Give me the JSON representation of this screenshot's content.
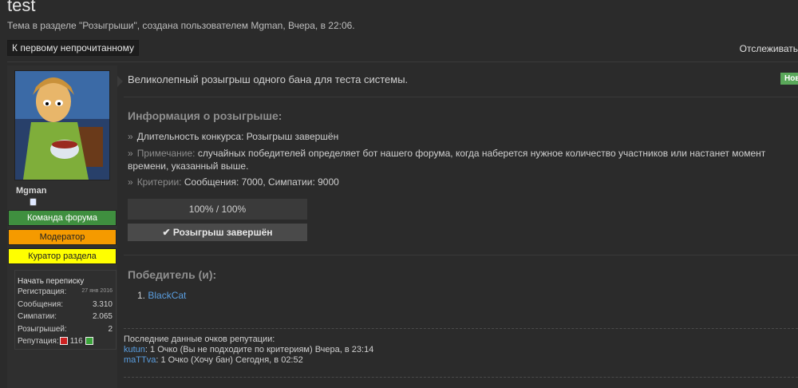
{
  "thread": {
    "title": "test",
    "subtitle": "Тема в разделе \"Розыгрыши\", создана пользователем Mgman, Вчера, в 22:06.",
    "first_unread": "К первому непрочитанному",
    "watch": "Отслеживать"
  },
  "user": {
    "name": "Mgman",
    "badges": [
      "Команда форума",
      "Модератор",
      "Куратор раздела"
    ],
    "start_conversation": "Начать переписку",
    "stats": {
      "registration_label": "Регистрация:",
      "registration_value": "27 янв 2016",
      "messages_label": "Сообщения:",
      "messages_value": "3.310",
      "likes_label": "Симпатии:",
      "likes_value": "2.065",
      "giveaways_label": "Розыгрышей:",
      "giveaways_value": "2",
      "reputation_label": "Репутация:",
      "reputation_value": "116"
    }
  },
  "post": {
    "lead": "Великолепный розыгрыш одного бана для теста системы.",
    "new_tag": "Нов",
    "info_heading": "Информация о розыгрыше:",
    "duration_text": "Длительность конкурса: Розыгрыш завершён",
    "note_label": "Примечание:",
    "note_text": "случайных победителей определяет бот нашего форума, когда наберется нужное количество участников или настанет момент времени, указанный выше.",
    "criteria_label": "Критерии:",
    "criteria_text": "Сообщения: 7000, Симпатии: 9000",
    "progress_text": "100% / 100%",
    "finished_text": "Розыгрыш завершён",
    "winners_heading": "Победитель (и):",
    "winners": [
      {
        "num": "1.",
        "name": "BlackCat"
      }
    ]
  },
  "reputation": {
    "heading": "Последние данные очков репутации:",
    "entries": [
      {
        "user": "kutun",
        "text": ": 1 Очко (Вы не подходите по критериям) Вчера, в 23:14"
      },
      {
        "user": "maTTva",
        "text": ": 1 Очко (Хочу бан) Сегодня, в 02:52"
      }
    ]
  },
  "colors": {
    "background": "#2b2b2b",
    "link": "#5a9ee0",
    "badge_green": "#3f8f3f",
    "badge_orange": "#f59a00",
    "badge_yellow": "#ffff00"
  }
}
